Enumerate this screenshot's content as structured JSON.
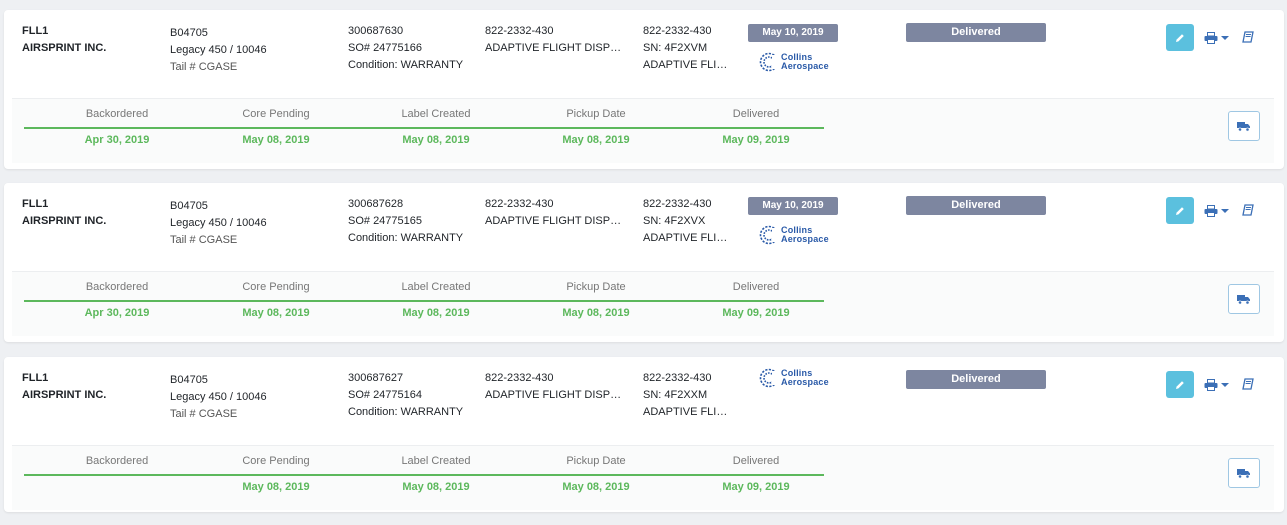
{
  "logo_text": [
    "Collins",
    "Aerospace"
  ],
  "colors": {
    "status": "#7d86a0",
    "edit": "#5bc0de",
    "progress": "#5cb85c"
  },
  "icons": {
    "edit": "pencil-icon",
    "print": "printer-icon",
    "dropdown": "caret-down-icon",
    "book": "book-icon",
    "truck": "truck-icon",
    "logo": "collins-aerospace-logo"
  },
  "orders": [
    {
      "station": "FLL1",
      "customer": "AIRSPRINT INC.",
      "aircraft_id": "B04705",
      "aircraft_model": "Legacy 450 / 10046",
      "tail": "Tail # CGASE",
      "order_no": "300687630",
      "so": "SO# 24775166",
      "condition": "Condition: WARRANTY",
      "part_no": "822-2332-430",
      "part_desc": "ADAPTIVE FLIGHT DISPLAY",
      "part_no2": "822-2332-430",
      "serial": "SN: 4F2XVM",
      "part_desc2": "ADAPTIVE FLIGHT DISPLAY",
      "date_badge": "May 10, 2019",
      "status": "Delivered",
      "steps": [
        {
          "label": "Backordered",
          "date": "Apr 30, 2019"
        },
        {
          "label": "Core Pending",
          "date": "May 08, 2019"
        },
        {
          "label": "Label Created",
          "date": "May 08, 2019"
        },
        {
          "label": "Pickup Date",
          "date": "May 08, 2019"
        },
        {
          "label": "Delivered",
          "date": "May 09, 2019"
        }
      ]
    },
    {
      "station": "FLL1",
      "customer": "AIRSPRINT INC.",
      "aircraft_id": "B04705",
      "aircraft_model": "Legacy 450 / 10046",
      "tail": "Tail # CGASE",
      "order_no": "300687628",
      "so": "SO# 24775165",
      "condition": "Condition: WARRANTY",
      "part_no": "822-2332-430",
      "part_desc": "ADAPTIVE FLIGHT DISPLAY",
      "part_no2": "822-2332-430",
      "serial": "SN: 4F2XVX",
      "part_desc2": "ADAPTIVE FLIGHT DISPLAY",
      "date_badge": "May 10, 2019",
      "status": "Delivered",
      "steps": [
        {
          "label": "Backordered",
          "date": "Apr 30, 2019"
        },
        {
          "label": "Core Pending",
          "date": "May 08, 2019"
        },
        {
          "label": "Label Created",
          "date": "May 08, 2019"
        },
        {
          "label": "Pickup Date",
          "date": "May 08, 2019"
        },
        {
          "label": "Delivered",
          "date": "May 09, 2019"
        }
      ]
    },
    {
      "station": "FLL1",
      "customer": "AIRSPRINT INC.",
      "aircraft_id": "B04705",
      "aircraft_model": "Legacy 450 / 10046",
      "tail": "Tail # CGASE",
      "order_no": "300687627",
      "so": "SO# 24775164",
      "condition": "Condition: WARRANTY",
      "part_no": "822-2332-430",
      "part_desc": "ADAPTIVE FLIGHT DISPLAY",
      "part_no2": "822-2332-430",
      "serial": "SN: 4F2XXM",
      "part_desc2": "ADAPTIVE FLIGHT DISPLAY",
      "date_badge": "",
      "status": "Delivered",
      "steps": [
        {
          "label": "Backordered",
          "date": ""
        },
        {
          "label": "Core Pending",
          "date": "May 08, 2019"
        },
        {
          "label": "Label Created",
          "date": "May 08, 2019"
        },
        {
          "label": "Pickup Date",
          "date": "May 08, 2019"
        },
        {
          "label": "Delivered",
          "date": "May 09, 2019"
        }
      ]
    }
  ]
}
